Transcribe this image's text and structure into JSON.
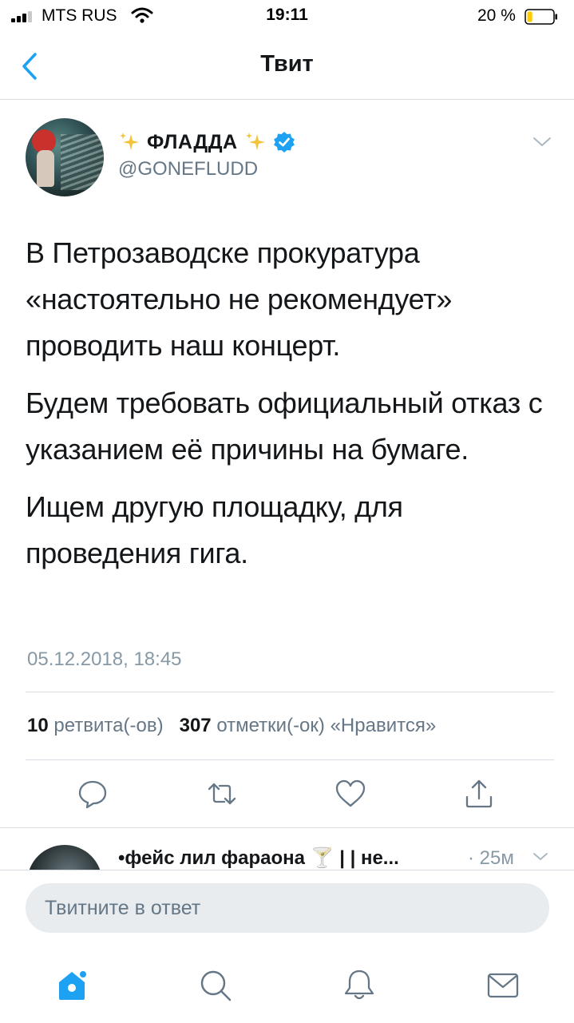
{
  "status_bar": {
    "carrier": "MTS RUS",
    "time": "19:11",
    "battery_percent": "20 %",
    "battery_level": 0.2
  },
  "nav": {
    "title": "Твит"
  },
  "tweet": {
    "author_name": "ФЛАДДА",
    "author_handle": "@GONEFLUDD",
    "paragraphs": [
      "В Петрозаводске прокуратура «настоятельно не рекомендует» проводить наш концерт.",
      "Будем требовать официальный отказ с указанием её причины на бумаге.",
      "Ищем другую площадку, для проведения гига."
    ],
    "timestamp": "05.12.2018, 18:45",
    "retweet_count": "10",
    "retweet_label": "ретвита(-ов)",
    "like_count": "307",
    "like_label": "отметки(-ок) «Нравится»"
  },
  "reply_preview": {
    "name": "•фейс лил фараона 🍸 | | не...",
    "time": "· 25м"
  },
  "composer": {
    "placeholder": "Твитните в ответ"
  },
  "icons": {
    "back": "chevron-left-icon",
    "sparkle": "sparkles-icon",
    "verified": "verified-badge-icon",
    "actions": [
      "reply-icon",
      "retweet-icon",
      "like-icon",
      "share-icon"
    ],
    "tabs": [
      "home-icon",
      "search-icon",
      "notifications-icon",
      "messages-icon"
    ]
  },
  "colors": {
    "accent": "#1da1f2",
    "text_secondary": "#657786",
    "divider": "#d7dde2"
  }
}
